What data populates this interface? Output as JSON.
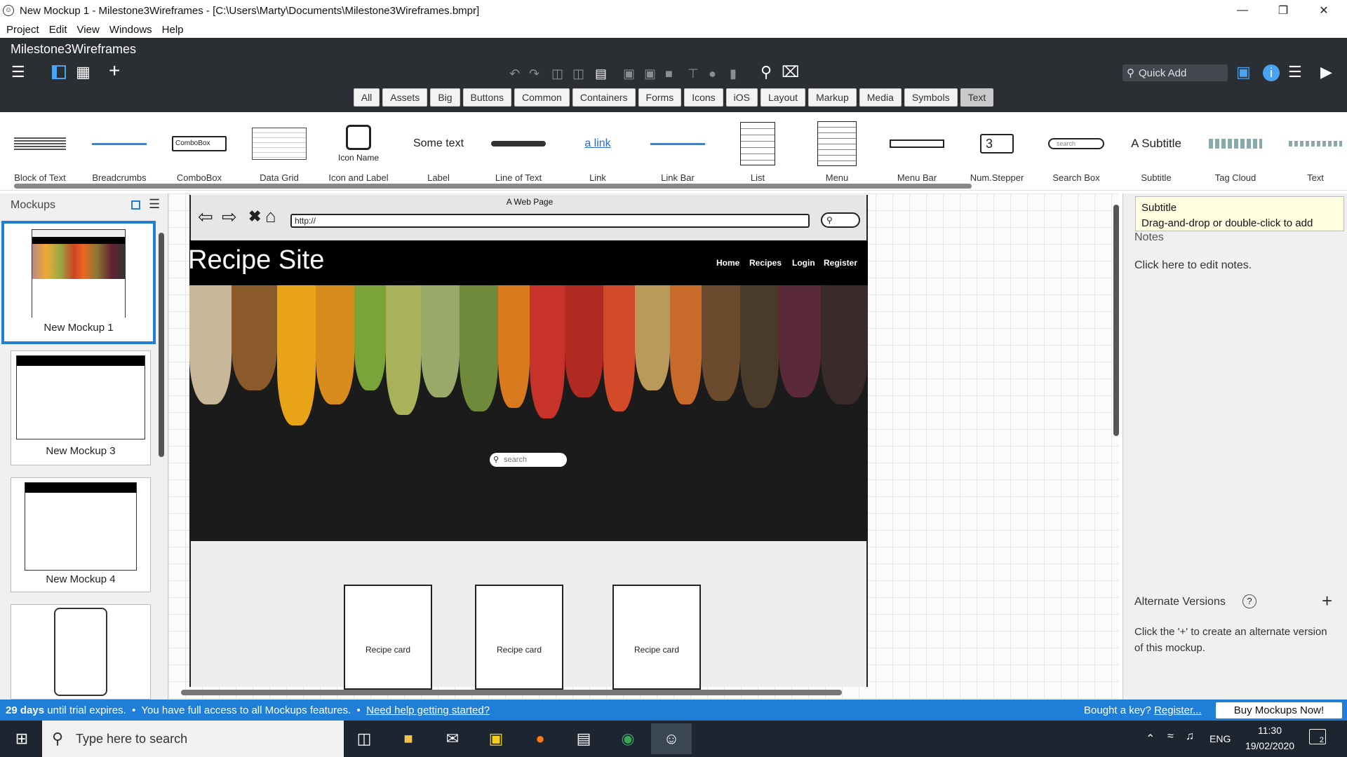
{
  "window": {
    "title": "New Mockup 1 - Milestone3Wireframes - [C:\\Users\\Marty\\Documents\\Milestone3Wireframes.bmpr]",
    "minimize": "—",
    "restore": "❐",
    "close": "✕"
  },
  "menubar": [
    "Project",
    "Edit",
    "View",
    "Windows",
    "Help"
  ],
  "app": {
    "project_name": "Milestone3Wireframes",
    "quick_add_placeholder": "Quick Add"
  },
  "filters": [
    "All",
    "Assets",
    "Big",
    "Buttons",
    "Common",
    "Containers",
    "Forms",
    "Icons",
    "iOS",
    "Layout",
    "Markup",
    "Media",
    "Symbols",
    "Text"
  ],
  "filters_selected": "Text",
  "library": {
    "items": [
      "Block of Text",
      "Breadcrumbs",
      "ComboBox",
      "Data Grid",
      "Icon and Label",
      "Label",
      "Line of Text",
      "Link",
      "Link Bar",
      "List",
      "Menu",
      "Menu Bar",
      "Num.Stepper",
      "Search Box",
      "Subtitle",
      "Tag Cloud",
      "Text"
    ],
    "preview_combobox": "ComboBox",
    "preview_icon_name": "Icon Name",
    "preview_label": "Some text",
    "preview_link": "a link",
    "preview_stepper": "3",
    "preview_search": "search",
    "preview_subtitle": "A Subtitle"
  },
  "mockups_panel": {
    "title": "Mockups",
    "items": [
      "New Mockup 1",
      "New Mockup 3",
      "New Mockup 4"
    ]
  },
  "canvas": {
    "web_page_title": "A Web Page",
    "url": "http://",
    "site_title": "Recipe Site",
    "nav": [
      "Home",
      "Recipes",
      "Login",
      "Register"
    ],
    "hero_search_placeholder": "search",
    "cards": [
      "Recipe card",
      "Recipe card",
      "Recipe card"
    ]
  },
  "right_panel": {
    "tooltip_title": "Subtitle",
    "tooltip_text": "Drag-and-drop or double-click to add",
    "notes_label": "Notes",
    "notes_hint": "Click here to edit notes.",
    "alt_versions_label": "Alternate Versions",
    "alt_help": "?",
    "alt_hint": "Click the '+' to create an alternate version of this mockup."
  },
  "status": {
    "days": "29 days",
    "trial_text": " until trial expires.  •  You have full access to all Mockups features.  •  ",
    "help_link": "Need help getting started?",
    "bought_text": "Bought a key? ",
    "register_link": "Register...",
    "buy_button": "Buy Mockups Now!"
  },
  "taskbar": {
    "search_placeholder": "Type here to search",
    "lang": "ENG",
    "time": "11:30",
    "date": "19/02/2020",
    "notifications": "2"
  },
  "colors": {
    "accent": "#1f7ed8",
    "header_dark": "#2b2e33",
    "taskbar": "#1c2530"
  }
}
